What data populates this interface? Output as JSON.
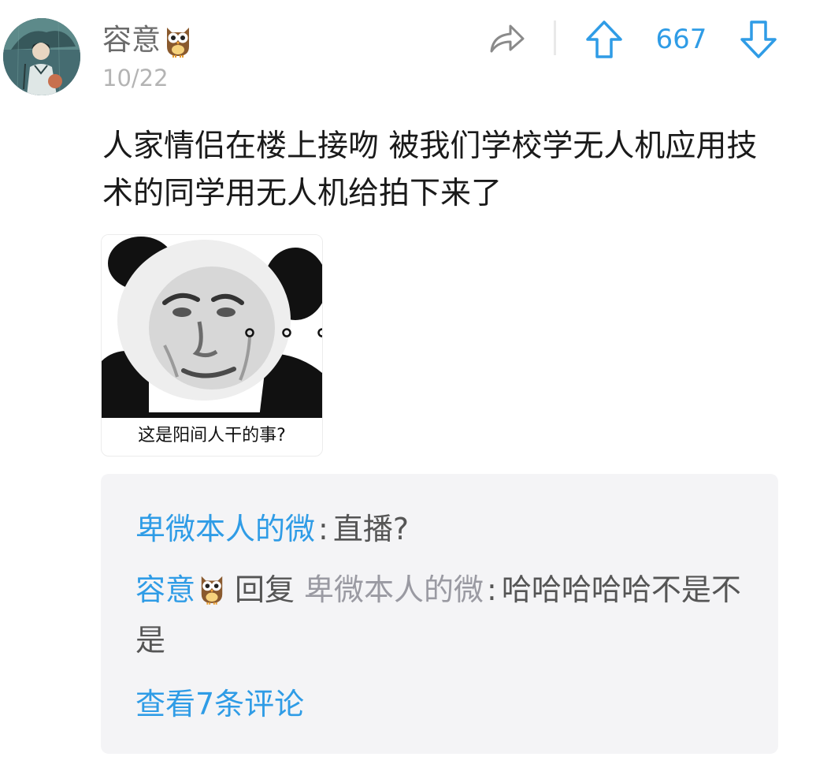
{
  "post": {
    "author": "容意",
    "author_badge_icon": "owl-icon",
    "date": "10/22",
    "score": "667",
    "content": "人家情侣在楼上接吻 被我们学校学无人机应用技术的同学用无人机给拍下来了",
    "image": {
      "caption": "这是阳间人干的事?",
      "overlay_text": "o o o"
    }
  },
  "comments": {
    "items": [
      {
        "user": "卑微本人的微",
        "separator": ":",
        "text": "直播?"
      },
      {
        "user": "容意",
        "reply_label": "回复",
        "reply_to": "卑微本人的微",
        "separator": ":",
        "text": "哈哈哈哈哈不是不是"
      }
    ],
    "view_all": "查看7条评论"
  },
  "colors": {
    "accent": "#2f9ce6",
    "text_primary": "#1a1a1a",
    "text_secondary": "#6b6b6b",
    "text_muted": "#b4b4b4",
    "comment_bg": "#f4f4f6"
  }
}
